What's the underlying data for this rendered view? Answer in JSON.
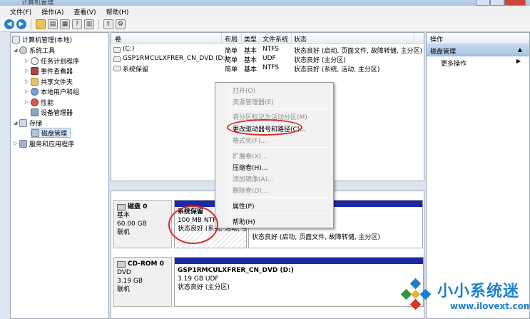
{
  "window": {
    "title": "计算机管理"
  },
  "menu": [
    "文件(F)",
    "操作(A)",
    "查看(V)",
    "帮助(H)"
  ],
  "toolbar": {
    "icons": [
      "back-arrow-icon",
      "forward-arrow-icon",
      "up-folder-icon",
      "console-tree-icon",
      "properties-icon",
      "help-icon",
      "refresh-icon",
      "export-icon"
    ]
  },
  "tree": {
    "root": "计算机管理(本地)",
    "system_tools": "系统工具",
    "task_scheduler": "任务计划程序",
    "event_viewer": "事件查看器",
    "shared_folders": "共享文件夹",
    "local_users": "本地用户和组",
    "performance": "性能",
    "device_manager": "设备管理器",
    "storage": "存储",
    "disk_management": "磁盘管理",
    "services": "服务和应用程序"
  },
  "volumes": {
    "headers": {
      "volume": "卷",
      "layout": "布局",
      "type": "类型",
      "fs": "文件系统",
      "status": "状态"
    },
    "rows": [
      {
        "name": "(C:)",
        "layout": "简单",
        "type": "基本",
        "fs": "NTFS",
        "status": "状态良好 (启动, 页面文件, 故障转储, 主分区)"
      },
      {
        "name": "GSP1RMCULXFRER_CN_DVD (D:)",
        "layout": "简单",
        "type": "基本",
        "fs": "UDF",
        "status": "状态良好 (主分区)"
      },
      {
        "name": "系统保留",
        "layout": "简单",
        "type": "基本",
        "fs": "NTFS",
        "status": "状态良好 (系统, 活动, 主分区)"
      }
    ]
  },
  "disks": {
    "disk0": {
      "name": "磁盘 0",
      "type": "基本",
      "size": "60.00 GB",
      "status": "联机"
    },
    "disk0_part1": {
      "name": "系统保留",
      "size": "100 MB NTF",
      "status": "状态良好 (系统, 活动, 主"
    },
    "disk0_part2": {
      "status": "状态良好 (启动, 页面文件, 故障转储, 主分区)"
    },
    "cdrom": {
      "name": "CD-ROM 0",
      "type": "DVD",
      "size": "3.19 GB",
      "status": "联机"
    },
    "cdrom_part": {
      "name": "GSP1RMCULXFRER_CN_DVD  (D:)",
      "size": "3.19 GB UDF",
      "status": "状态良好 (主分区)"
    }
  },
  "actions": {
    "header": "操作",
    "section": "磁盘管理",
    "more": "更多操作"
  },
  "context_menu": {
    "open": "打开(O)",
    "explore": "资源管理器(E)",
    "mark_active": "将分区标记为活动分区(M)",
    "change_letter": "更改驱动器号和路径(C)...",
    "format": "格式化(F)...",
    "extend": "扩展卷(X)...",
    "shrink": "压缩卷(H)...",
    "add_mirror": "添加镜像(A)...",
    "delete": "删除卷(D)...",
    "properties": "属性(P)",
    "help": "帮助(H)"
  },
  "watermark": {
    "title": "小小系统迷",
    "url": "www.ilovext.com"
  }
}
